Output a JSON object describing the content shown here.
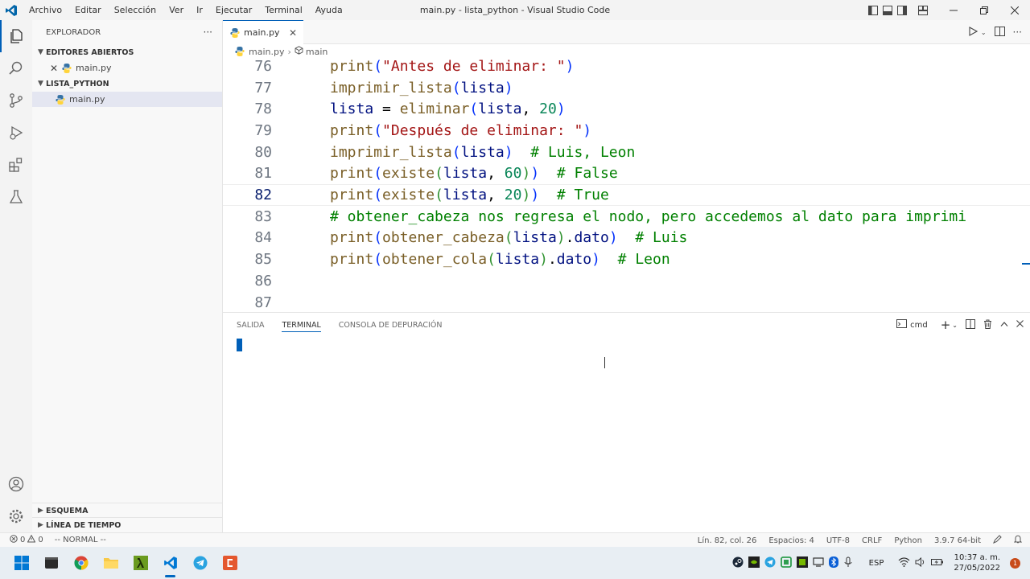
{
  "titlebar": {
    "menu": [
      "Archivo",
      "Editar",
      "Selección",
      "Ver",
      "Ir",
      "Ejecutar",
      "Terminal",
      "Ayuda"
    ],
    "title": "main.py - lista_python - Visual Studio Code"
  },
  "sidebar": {
    "header": "EXPLORADOR",
    "more": "···",
    "open_editors": "EDITORES ABIERTOS",
    "open_file": "main.py",
    "folder": "LISTA_PYTHON",
    "folder_file": "main.py",
    "outline": "ESQUEMA",
    "timeline": "LÍNEA DE TIEMPO"
  },
  "editor": {
    "tab": "main.py",
    "breadcrumb_file": "main.py",
    "breadcrumb_symbol": "main",
    "lines": [
      {
        "n": "76",
        "code": "print(\"Antes de eliminar: \")"
      },
      {
        "n": "77",
        "code": "imprimir_lista(lista)"
      },
      {
        "n": "78",
        "code": "lista = eliminar(lista, 20)"
      },
      {
        "n": "79",
        "code": "print(\"Después de eliminar: \")"
      },
      {
        "n": "80",
        "code": "imprimir_lista(lista)  # Luis, Leon"
      },
      {
        "n": "81",
        "code": "print(existe(lista, 60))  # False"
      },
      {
        "n": "82",
        "code": "print(existe(lista, 20))  # True"
      },
      {
        "n": "83",
        "code": "# obtener_cabeza nos regresa el nodo, pero accedemos al dato para imprimi"
      },
      {
        "n": "84",
        "code": "print(obtener_cabeza(lista).dato)  # Luis"
      },
      {
        "n": "85",
        "code": "print(obtener_cola(lista).dato)  # Leon"
      },
      {
        "n": "86",
        "code": ""
      },
      {
        "n": "87",
        "code": ""
      }
    ]
  },
  "panel": {
    "tabs": [
      "SALIDA",
      "TERMINAL",
      "CONSOLA DE DEPURACIÓN"
    ],
    "shell": "cmd"
  },
  "status": {
    "errors": "0",
    "warnings": "0",
    "mode": "-- NORMAL --",
    "position": "Lín. 82, col. 26",
    "spaces": "Espacios: 4",
    "encoding": "UTF-8",
    "eol": "CRLF",
    "language": "Python",
    "interpreter": "3.9.7 64-bit"
  },
  "taskbar": {
    "lang": "ESP",
    "time": "10:37 a. m.",
    "date": "27/05/2022",
    "notifications": "1"
  },
  "colors": {
    "accent": "#005fb8",
    "python_blue": "#3572A5",
    "python_yellow": "#FFD43B"
  }
}
